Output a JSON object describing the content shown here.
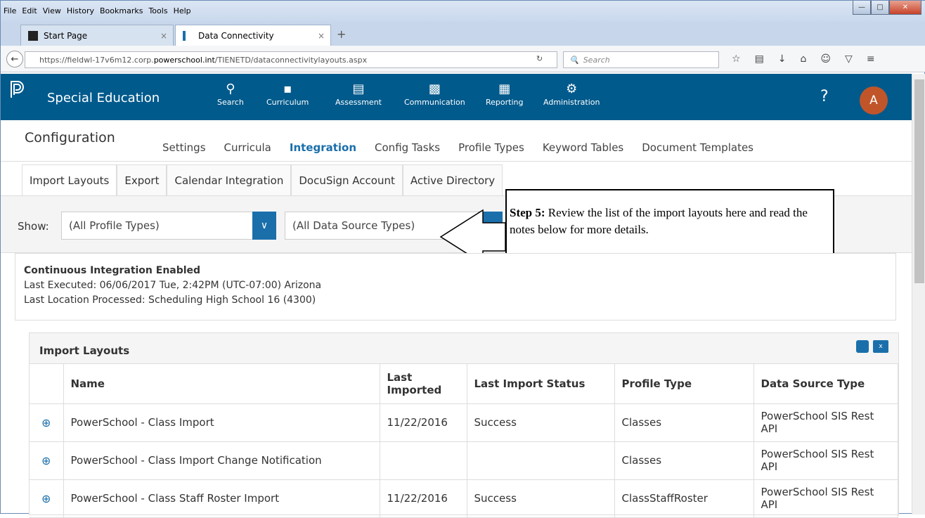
{
  "browser": {
    "menu": [
      "File",
      "Edit",
      "View",
      "History",
      "Bookmarks",
      "Tools",
      "Help"
    ],
    "tabs": [
      {
        "label": "Start Page"
      },
      {
        "label": "Data Connectivity"
      }
    ],
    "url_prefix": "https://fieldwl-17v6m12.corp.",
    "url_domain": "powerschool.int",
    "url_suffix": "/TIENETD/dataconnectivitylayouts.aspx",
    "search_placeholder": "Search"
  },
  "app": {
    "name": "Special Education",
    "nav": [
      {
        "label": "Search",
        "icon": "search-icon"
      },
      {
        "label": "Curriculum",
        "icon": "book-icon"
      },
      {
        "label": "Assessment",
        "icon": "clipboard-icon"
      },
      {
        "label": "Communication",
        "icon": "communication-icon"
      },
      {
        "label": "Reporting",
        "icon": "document-icon"
      },
      {
        "label": "Administration",
        "icon": "gear-icon"
      }
    ],
    "help": "?",
    "avatar": "A"
  },
  "config": {
    "title": "Configuration",
    "tabs": [
      "Settings",
      "Curricula",
      "Integration",
      "Config Tasks",
      "Profile Types",
      "Keyword Tables",
      "Document Templates"
    ],
    "subtabs": [
      "Import Layouts",
      "Export",
      "Calendar Integration",
      "DocuSign Account",
      "Active Directory"
    ]
  },
  "filters": {
    "show_label": "Show:",
    "profile_types": "(All Profile Types)",
    "data_source_types": "(All Data Source Types)"
  },
  "callout": {
    "step": "Step 5:",
    "text": " Review the list of the import layouts here and read the notes below for more details."
  },
  "info": {
    "title": "Continuous Integration Enabled",
    "last_executed": "Last Executed: 06/06/2017 Tue, 2:42PM (UTC-07:00) Arizona",
    "last_location": "Last Location Processed: Scheduling High School 16 (4300)"
  },
  "layouts": {
    "title": "Import Layouts",
    "columns": [
      "Name",
      "Last Imported",
      "Last Import Status",
      "Profile Type",
      "Data Source Type"
    ],
    "rows": [
      {
        "name": "PowerSchool - Class Import",
        "last_imported": "11/22/2016",
        "status": "Success",
        "profile_type": "Classes",
        "source": "PowerSchool SIS Rest API"
      },
      {
        "name": "PowerSchool - Class Import Change Notification",
        "last_imported": "",
        "status": "",
        "profile_type": "Classes",
        "source": "PowerSchool SIS Rest API"
      },
      {
        "name": "PowerSchool - Class Staff Roster Import",
        "last_imported": "11/22/2016",
        "status": "Success",
        "profile_type": "ClassStaffRoster",
        "source": "PowerSchool SIS Rest API"
      }
    ]
  }
}
